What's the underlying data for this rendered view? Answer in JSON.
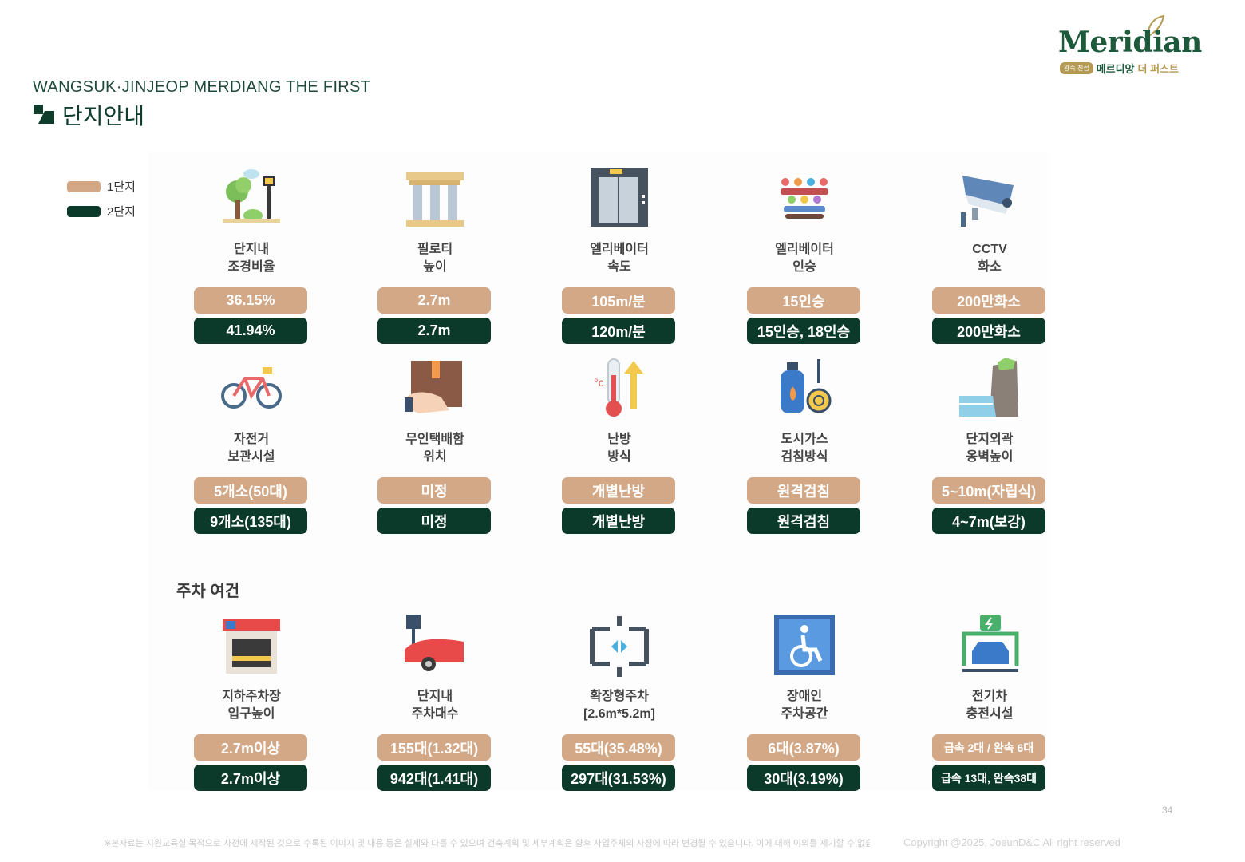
{
  "header": {
    "subtitle": "WANGSUK·JINJEOP MERDIANG THE FIRST",
    "title": "단지안내"
  },
  "logo": {
    "wordmark": "Meridian",
    "badge": "왕숙 진접",
    "name_part1": "메르디앙",
    "name_part2": "더 퍼스트"
  },
  "legend": [
    {
      "label": "1단지",
      "color": "#d3a886"
    },
    {
      "label": "2단지",
      "color": "#0b3a2a"
    }
  ],
  "features_row1": [
    {
      "icon": "park-icon",
      "line1": "단지내",
      "line2": "조경비율",
      "v1": "36.15%",
      "v2": "41.94%"
    },
    {
      "icon": "pillar-icon",
      "line1": "필로티",
      "line2": "높이",
      "v1": "2.7m",
      "v2": "2.7m"
    },
    {
      "icon": "elevator-icon",
      "line1": "엘리베이터",
      "line2": "속도",
      "v1": "105m/분",
      "v2": "120m/분"
    },
    {
      "icon": "people-icon",
      "line1": "엘리베이터",
      "line2": "인승",
      "v1": "15인승",
      "v2": "15인승, 18인승"
    },
    {
      "icon": "cctv-icon",
      "line1": "CCTV",
      "line2": "화소",
      "v1": "200만화소",
      "v2": "200만화소"
    }
  ],
  "features_row2": [
    {
      "icon": "bicycle-icon",
      "line1": "자전거",
      "line2": "보관시설",
      "v1": "5개소(50대)",
      "v2": "9개소(135대)"
    },
    {
      "icon": "parcel-icon",
      "line1": "무인택배함",
      "line2": "위치",
      "v1": "미정",
      "v2": "미정"
    },
    {
      "icon": "thermometer-icon",
      "line1": "난방",
      "line2": "방식",
      "v1": "개별난방",
      "v2": "개별난방"
    },
    {
      "icon": "gas-meter-icon",
      "line1": "도시가스",
      "line2": "검침방식",
      "v1": "원격검침",
      "v2": "원격검침"
    },
    {
      "icon": "retaining-wall-icon",
      "line1": "단지외곽",
      "line2": "옹벽높이",
      "v1": "5~10m(자립식)",
      "v2": "4~7m(보강)"
    }
  ],
  "parking": {
    "title": "주차 여건",
    "items": [
      {
        "icon": "parking-garage-icon",
        "line1": "지하주차장",
        "line2": "입구높이",
        "v1": "2.7m이상",
        "v2": "2.7m이상"
      },
      {
        "icon": "parking-car-icon",
        "line1": "단지내",
        "line2": "주차대수",
        "v1": "155대(1.32대)",
        "v2": "942대(1.41대)"
      },
      {
        "icon": "wide-parking-icon",
        "line1": "확장형주차",
        "line2": "[2.6m*5.2m]",
        "v1": "55대(35.48%)",
        "v2": "297대(31.53%)"
      },
      {
        "icon": "wheelchair-icon",
        "line1": "장애인",
        "line2": "주차공간",
        "v1": "6대(3.87%)",
        "v2": "30대(3.19%)"
      },
      {
        "icon": "ev-charger-icon",
        "line1": "전기차",
        "line2": "충전시설",
        "v1": "급속 2대 / 완속 6대",
        "v2": "급속 13대, 완속38대"
      }
    ]
  },
  "footer": {
    "note": "※본자료는 지원교육실 목적으로 사전에 제작된 것으로 수록된 이미지 및 내용 등은 실제와 다를 수 있으며 건축계획 및 세부계획은 향후 사업주체의 사정에 따라 변경될 수 있습니다. 이에 대해 이의를 제기할 수 없습니다.",
    "copyright": "Copyright @2025, JoeunD&C All right reserved",
    "page": "34"
  }
}
